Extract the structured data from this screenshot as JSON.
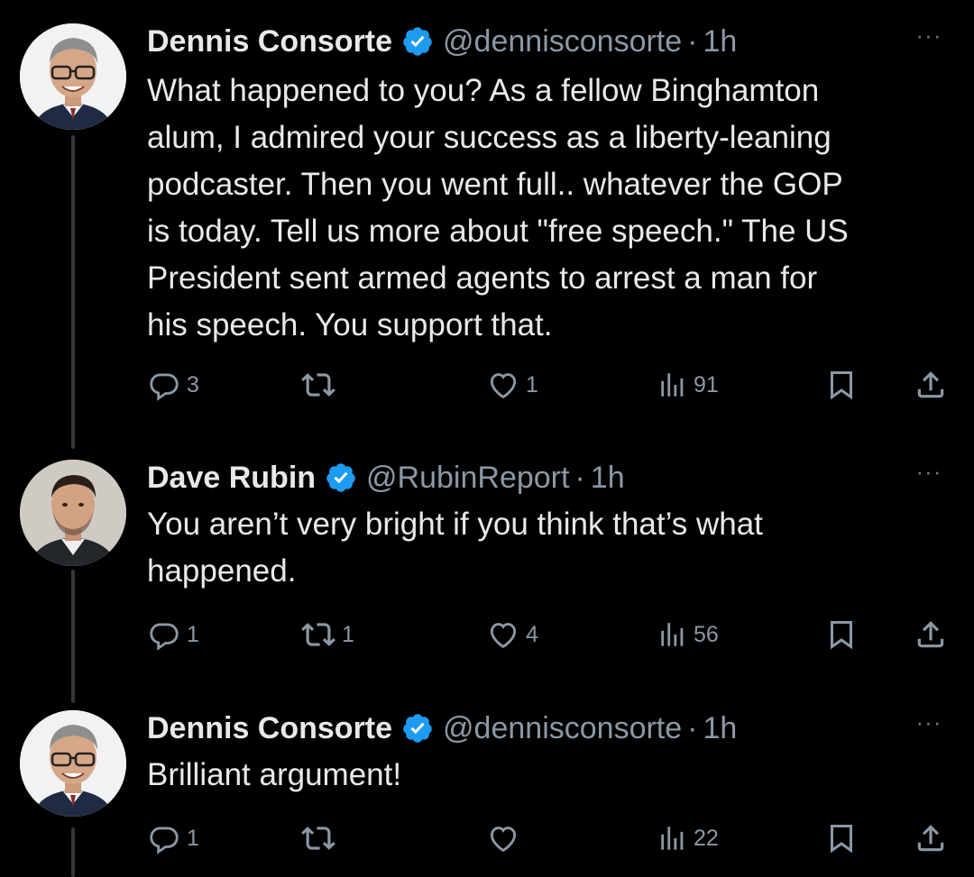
{
  "tweets": [
    {
      "name": "Dennis Consorte",
      "handle": "@dennisconsorte",
      "separator": "·",
      "time": "1h",
      "more": "···",
      "text": "What happened to you? As a fellow Binghamton\nalum, I admired your success as a liberty-leaning\npodcaster. Then you went full.. whatever the GOP\nis today. Tell us more about \"free speech.\" The US\nPresident sent armed agents to arrest a man for\nhis speech. You support that.",
      "replies": "3",
      "reposts": "",
      "likes": "1",
      "views": "91"
    },
    {
      "name": "Dave Rubin",
      "handle": "@RubinReport",
      "separator": "·",
      "time": "1h",
      "more": "···",
      "text": "You aren’t very bright if you think that’s what\nhappened.",
      "replies": "1",
      "reposts": "1",
      "likes": "4",
      "views": "56"
    },
    {
      "name": "Dennis Consorte",
      "handle": "@dennisconsorte",
      "separator": "·",
      "time": "1h",
      "more": "···",
      "text": "Brilliant argument!",
      "replies": "1",
      "reposts": "",
      "likes": "",
      "views": "22"
    }
  ],
  "icons": {
    "reply": "reply-icon",
    "repost": "repost-icon",
    "like": "heart-icon",
    "views": "views-icon",
    "bookmark": "bookmark-icon",
    "share": "share-icon",
    "verified": "verified-badge-icon"
  },
  "colors": {
    "background": "#000000",
    "text": "#e7e9ea",
    "secondary": "#8b98a5",
    "verified": "#1d9bf0",
    "thread_line": "#333639"
  }
}
